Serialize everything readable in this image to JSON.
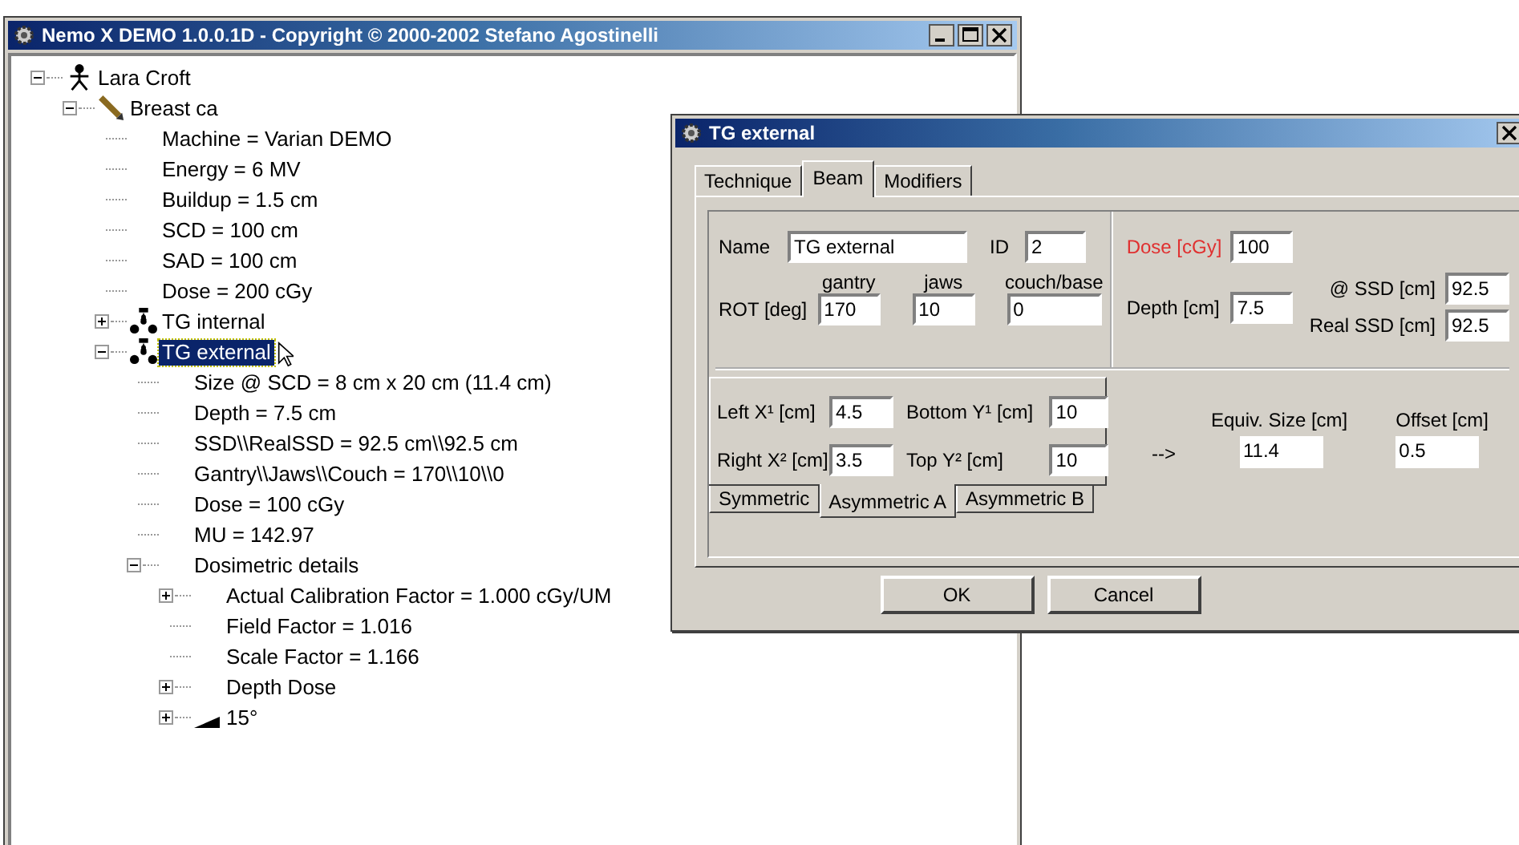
{
  "main_window": {
    "title": "Nemo  X DEMO 1.0.0.1D - Copyright © 2000-2002 Stefano Agostinelli"
  },
  "tree": [
    {
      "label": "Lara Croft",
      "kind": "person",
      "expanded": true,
      "selected": false,
      "children": [
        {
          "label": "Breast ca",
          "kind": "pencil",
          "expanded": true,
          "selected": false,
          "children": [
            {
              "label": "Machine = Varian DEMO",
              "selected": false
            },
            {
              "label": "Energy = 6 MV",
              "selected": false
            },
            {
              "label": "Buildup = 1.5 cm",
              "selected": false
            },
            {
              "label": "SCD = 100 cm",
              "selected": false
            },
            {
              "label": "SAD = 100 cm",
              "selected": false
            },
            {
              "label": "Dose = 200 cGy",
              "selected": false
            },
            {
              "label": "TG internal",
              "kind": "beams",
              "expanded": false,
              "selected": false
            },
            {
              "label": "TG external",
              "kind": "beams",
              "expanded": true,
              "selected": true,
              "children": [
                {
                  "label": "Size @ SCD = 8 cm x 20 cm (11.4 cm)",
                  "selected": false
                },
                {
                  "label": "Depth = 7.5 cm",
                  "selected": false
                },
                {
                  "label": "SSD\\\\RealSSD = 92.5 cm\\\\92.5 cm",
                  "selected": false
                },
                {
                  "label": "Gantry\\\\Jaws\\\\Couch = 170\\\\10\\\\0",
                  "selected": false
                },
                {
                  "label": "Dose = 100 cGy",
                  "selected": false
                },
                {
                  "label": "MU = 142.97",
                  "selected": false
                },
                {
                  "label": "Dosimetric details",
                  "expanded": true,
                  "selected": false,
                  "children": [
                    {
                      "label": "Actual Calibration Factor = 1.000 cGy/UM",
                      "expanded": false,
                      "selected": false
                    },
                    {
                      "label": "Field Factor = 1.016",
                      "selected": false
                    },
                    {
                      "label": "Scale Factor = 1.166",
                      "selected": false
                    },
                    {
                      "label": "Depth Dose",
                      "expanded": false,
                      "selected": false
                    },
                    {
                      "label": "15°",
                      "kind": "wedge",
                      "expanded": false,
                      "selected": false
                    }
                  ]
                }
              ]
            }
          ]
        }
      ]
    }
  ],
  "dialog": {
    "title": "TG external",
    "tabs": [
      {
        "label": "Technique",
        "selected": false
      },
      {
        "label": "Beam",
        "selected": true
      },
      {
        "label": "Modifiers",
        "selected": false
      }
    ],
    "name_label": "Name",
    "name_value": "TG external",
    "id_label": "ID",
    "id_value": "2",
    "rot_label": "ROT [deg]",
    "rot_fields": [
      {
        "header": "gantry",
        "value": "170"
      },
      {
        "header": "jaws",
        "value": "10"
      },
      {
        "header": "couch/base",
        "value": "0"
      }
    ],
    "dose_label": "Dose [cGy]",
    "dose_value": "100",
    "depth_label": "Depth [cm]",
    "depth_value": "7.5",
    "ssd_label": "@ SSD [cm]",
    "ssd_value": "92.5",
    "real_ssd_label": "Real SSD [cm]",
    "real_ssd_value": "92.5",
    "jaw_fields": [
      {
        "label": "Left X¹ [cm]",
        "value": "4.5"
      },
      {
        "label": "Bottom Y¹ [cm]",
        "value": "10"
      },
      {
        "label": "Right X² [cm]",
        "value": "3.5"
      },
      {
        "label": "Top Y² [cm]",
        "value": "10"
      }
    ],
    "jaw_tabs": [
      {
        "label": "Symmetric",
        "selected": false
      },
      {
        "label": "Asymmetric A",
        "selected": true
      },
      {
        "label": "Asymmetric B",
        "selected": false
      }
    ],
    "arrow": "-->",
    "equiv_label": "Equiv. Size [cm]",
    "equiv_value": "11.4",
    "offset_label": "Offset [cm]",
    "offset_value": "0.5",
    "buttons": [
      "OK",
      "Cancel"
    ]
  }
}
